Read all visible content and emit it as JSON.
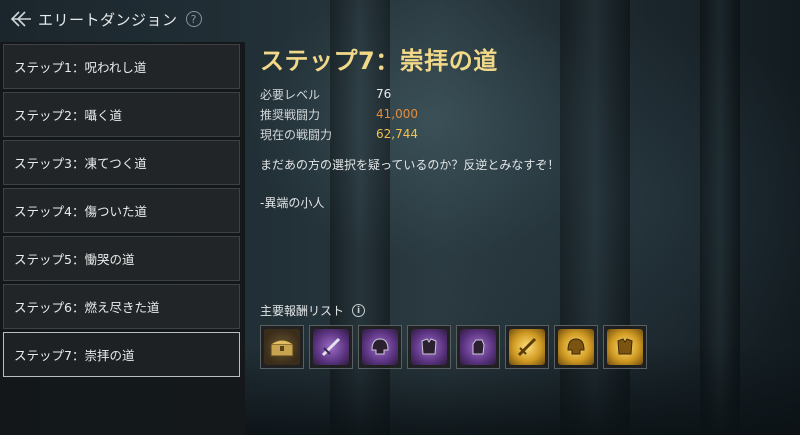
{
  "header": {
    "title": "エリートダンジョン",
    "help_glyph": "?",
    "back_icon": "back-arrow-icon"
  },
  "steps": [
    {
      "label": "ステップ1：呪われし道"
    },
    {
      "label": "ステップ2：囁く道"
    },
    {
      "label": "ステップ3：凍てつく道"
    },
    {
      "label": "ステップ4：傷ついた道"
    },
    {
      "label": "ステップ5：慟哭の道"
    },
    {
      "label": "ステップ6：燃え尽きた道"
    },
    {
      "label": "ステップ7：崇拝の道",
      "selected": true
    }
  ],
  "detail": {
    "title": "ステップ7：崇拝の道",
    "stats": [
      {
        "label": "必要レベル",
        "value": "76"
      },
      {
        "label": "推奨戦闘力",
        "value": "41,000"
      },
      {
        "label": "現在の戦闘力",
        "value": "62,744"
      }
    ],
    "description": "まだあの方の選択を疑っているのか？反逆とみなすぞ！",
    "signature": "-異端の小人"
  },
  "rewards": {
    "label": "主要報酬リスト",
    "info_glyph": "i",
    "items": [
      {
        "icon": "treasure-chest-icon",
        "rarity": "common"
      },
      {
        "icon": "purple-sword-icon",
        "rarity": "epic"
      },
      {
        "icon": "purple-helmet-icon",
        "rarity": "epic"
      },
      {
        "icon": "purple-armor-icon",
        "rarity": "epic"
      },
      {
        "icon": "purple-gauntlet-icon",
        "rarity": "epic"
      },
      {
        "icon": "gold-sword-icon",
        "rarity": "legendary"
      },
      {
        "icon": "gold-helmet-icon",
        "rarity": "legendary"
      },
      {
        "icon": "gold-armor-icon",
        "rarity": "legendary"
      }
    ]
  },
  "colors": {
    "title_gold": "#f2d98a",
    "recommended_power": "#e58c3d",
    "current_power": "#f0c24f"
  }
}
